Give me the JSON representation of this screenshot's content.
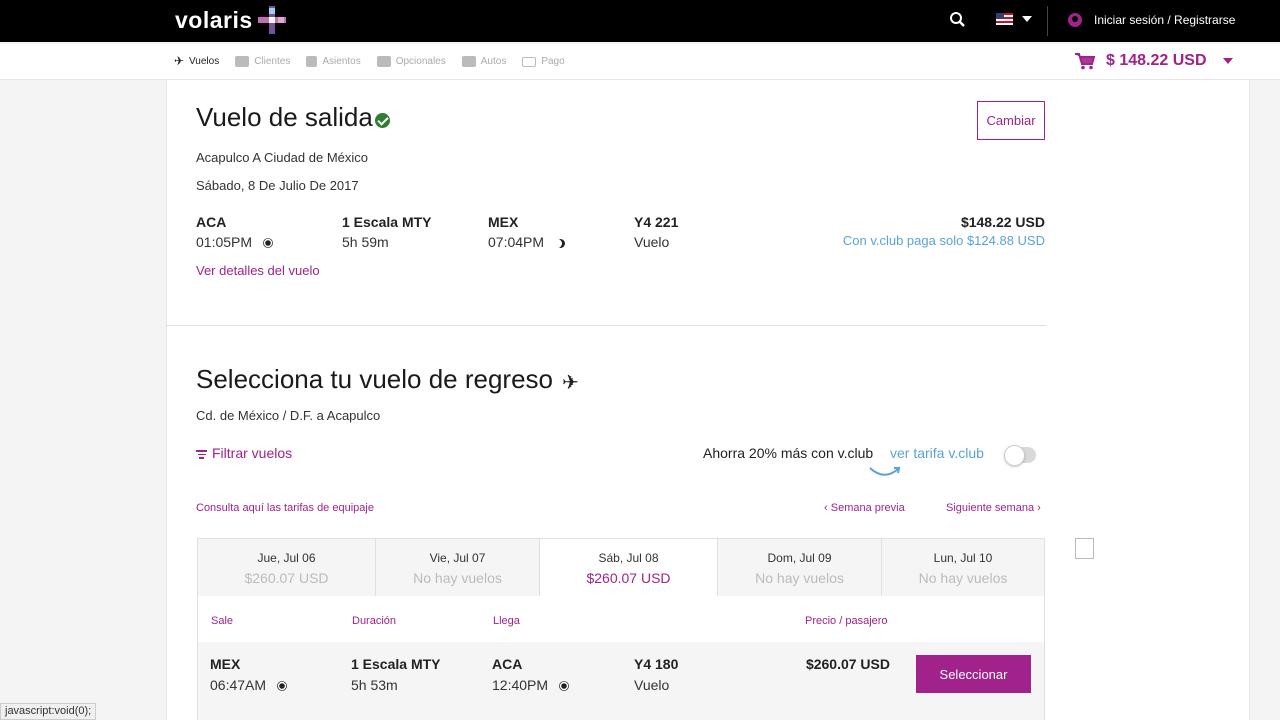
{
  "brand": {
    "name": "volaris",
    "accent": "#a0228a",
    "link_blue": "#5aa3d8"
  },
  "header": {
    "search_icon": "search-icon",
    "language": "en-US",
    "login_label": "Iniciar sesión / Registrarse"
  },
  "steps": [
    {
      "label": "Vuelos",
      "icon": "plane-icon",
      "active": true
    },
    {
      "label": "Clientes",
      "icon": "users-icon",
      "active": false
    },
    {
      "label": "Asientos",
      "icon": "seat-icon",
      "active": false
    },
    {
      "label": "Opcionales",
      "icon": "extras-icon",
      "active": false
    },
    {
      "label": "Autos",
      "icon": "car-icon",
      "active": false
    },
    {
      "label": "Pago",
      "icon": "card-icon",
      "active": false
    }
  ],
  "cart": {
    "total": "$ 148.22 USD"
  },
  "outbound": {
    "title": "Vuelo de salida",
    "change_label": "Cambiar",
    "route": "Acapulco A Ciudad de México",
    "date": "Sábado, 8 De Julio De 2017",
    "depart_code": "ACA",
    "depart_time": "01:05PM",
    "stops": "1 Escala MTY",
    "duration": "5h 59m",
    "arrive_code": "MEX",
    "arrive_time": "07:04PM",
    "flight_no": "Y4 221",
    "flight_type": "Vuelo",
    "price": "$148.22 USD",
    "vclub_text": "Con v.club paga solo",
    "vclub_price": "$124.88 USD",
    "details_link": "Ver detalles del vuelo"
  },
  "return": {
    "title": "Selecciona tu vuelo de regreso",
    "route": "Cd. de México / D.F. a Acapulco",
    "filter_label": "Filtrar vuelos",
    "vclub_promo": "Ahorra 20% más con v.club",
    "vclub_link": "ver tarifa v.club",
    "baggage_link": "Consulta aquí las tarifas de equipaje",
    "prev_week": "Semana previa",
    "next_week": "Siguiente semana",
    "dates": [
      {
        "day": "Jue, Jul 06",
        "price": "$260.07 USD",
        "active": false
      },
      {
        "day": "Vie, Jul 07",
        "price": "No hay vuelos",
        "active": false
      },
      {
        "day": "Sáb, Jul 08",
        "price": "$260.07 USD",
        "active": true
      },
      {
        "day": "Dom, Jul 09",
        "price": "No hay vuelos",
        "active": false
      },
      {
        "day": "Lun, Jul 10",
        "price": "No hay vuelos",
        "active": false
      }
    ],
    "columns": {
      "sale": "Sale",
      "duration": "Duración",
      "arrives": "Llega",
      "price": "Precio / pasajero"
    },
    "flights": [
      {
        "depart_code": "MEX",
        "depart_time": "06:47AM",
        "stops": "1 Escala MTY",
        "duration": "5h 53m",
        "arrive_code": "ACA",
        "arrive_time": "12:40PM",
        "flight_no": "Y4 180",
        "flight_type": "Vuelo",
        "price": "$260.07 USD",
        "select_label": "Seleccionar"
      }
    ]
  },
  "status_bar": "javascript:void(0);"
}
